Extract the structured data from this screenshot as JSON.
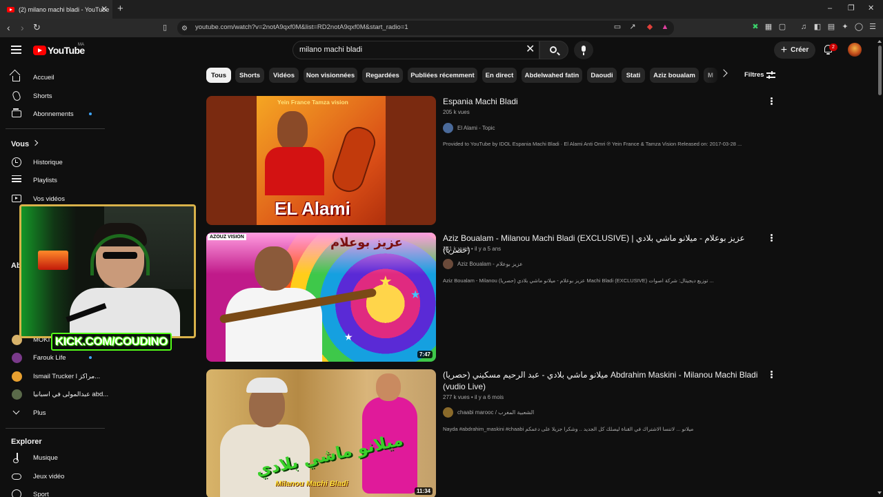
{
  "browser": {
    "tab_title": "(2) milano machi bladi - YouTube",
    "tab_close": "✕",
    "new_tab": "+",
    "url": "youtube.com/watch?v=2notA9qxf0M&list=RD2notA9qxf0M&start_radio=1",
    "window_controls": [
      "–",
      "❐",
      "✕"
    ]
  },
  "masthead": {
    "logo_text": "YouTube",
    "country_code": "MA",
    "search_query": "milano machi bladi",
    "create_label": "Créer",
    "notification_count": "2"
  },
  "sidebar": {
    "main": [
      {
        "label": "Accueil",
        "icon": "home-icon"
      },
      {
        "label": "Shorts",
        "icon": "shorts-icon"
      },
      {
        "label": "Abonnements",
        "icon": "subscriptions-icon"
      }
    ],
    "you_heading": "Vous",
    "you_items": [
      {
        "label": "Historique",
        "icon": "history-icon"
      },
      {
        "label": "Playlists",
        "icon": "playlists-icon"
      },
      {
        "label": "Vos vidéos",
        "icon": "your-videos-icon"
      }
    ],
    "subs_heading_partial": "Ab",
    "subscriptions": [
      {
        "label": "MOKI",
        "color": "#d7b26a"
      },
      {
        "label": "Farouk Life",
        "color": "#7a3a8a"
      },
      {
        "label": "Ismail Trucker l مراكز...",
        "color": "#e8a030"
      },
      {
        "label": "عبدالمولى في اسبانيا abd...",
        "color": "#5a6a4a"
      }
    ],
    "more_label": "Plus",
    "explore_heading": "Explorer",
    "explore": [
      {
        "label": "Musique",
        "icon": "music-icon"
      },
      {
        "label": "Jeux vidéo",
        "icon": "gaming-icon"
      },
      {
        "label": "Sport",
        "icon": "sport-icon"
      }
    ]
  },
  "chips": [
    "Tous",
    "Shorts",
    "Vidéos",
    "Non visionnées",
    "Regardées",
    "Publiées récemment",
    "En direct",
    "Abdelwahed fatin",
    "Daoudi",
    "Stati",
    "Aziz boualam",
    "M"
  ],
  "filters_label": "Filtres",
  "results": [
    {
      "title": "Espania Machi Bladi",
      "meta": "205 k vues",
      "channel": "El Alami - Topic",
      "channel_color": "#4a6a9a",
      "description": "Provided to YouTube by IDOL Espania Machi Bladi · El Alami Anti Omri ℗ Yein France & Tamza Vision Released on: 2017-03-28 ...",
      "duration": "",
      "thumb_brand": "Yein France Tamza vision",
      "thumb_text": "EL Alami"
    },
    {
      "title": "Aziz Boualam - Milanou Machi Bladi (EXCLUSIVE) | عزيز بوعلام - ميلانو ماشي بلادي (حصريا)",
      "meta": "341 k vues • il y a 5 ans",
      "channel": "Aziz Boualam - عزيز بوعلام",
      "channel_color": "#6a4a3a",
      "description": "Aziz Boualam - Milanou (حصريا) عزيز بوعلام - ميلانو ماشي بلادي Machi Bladi (EXCLUSIVE) توزيع ديجيتال: شركة اصوات ...",
      "duration": "7:47",
      "thumb_tag": "AZOUZ VISION",
      "thumb_arabic": "عزيز بوعلام"
    },
    {
      "title": "ميلانو ماشي بلادي - عبد الرحيم مسكيني (حصريا) Abdrahim Maskini - Milanou Machi Bladi (vudio Live)",
      "meta": "277 k vues • il y a 6 mois",
      "channel": "chaabi marooc / الشعبية المغرب",
      "channel_color": "#8a6a2a",
      "description": "Nayda #abdrahim_maskini #chaabi ميلانو ... لاتنسا الاشتراك في القناة ليصلك كل الجديد .. وشكرا جزيلا على دعمكم",
      "duration": "11:34",
      "thumb_arabic": "ميلانو ماشي بلادي",
      "thumb_latin": "Milanou Machi Bladi"
    }
  ],
  "overlay": {
    "kick_text": "KICK.COM/COUDINO"
  }
}
